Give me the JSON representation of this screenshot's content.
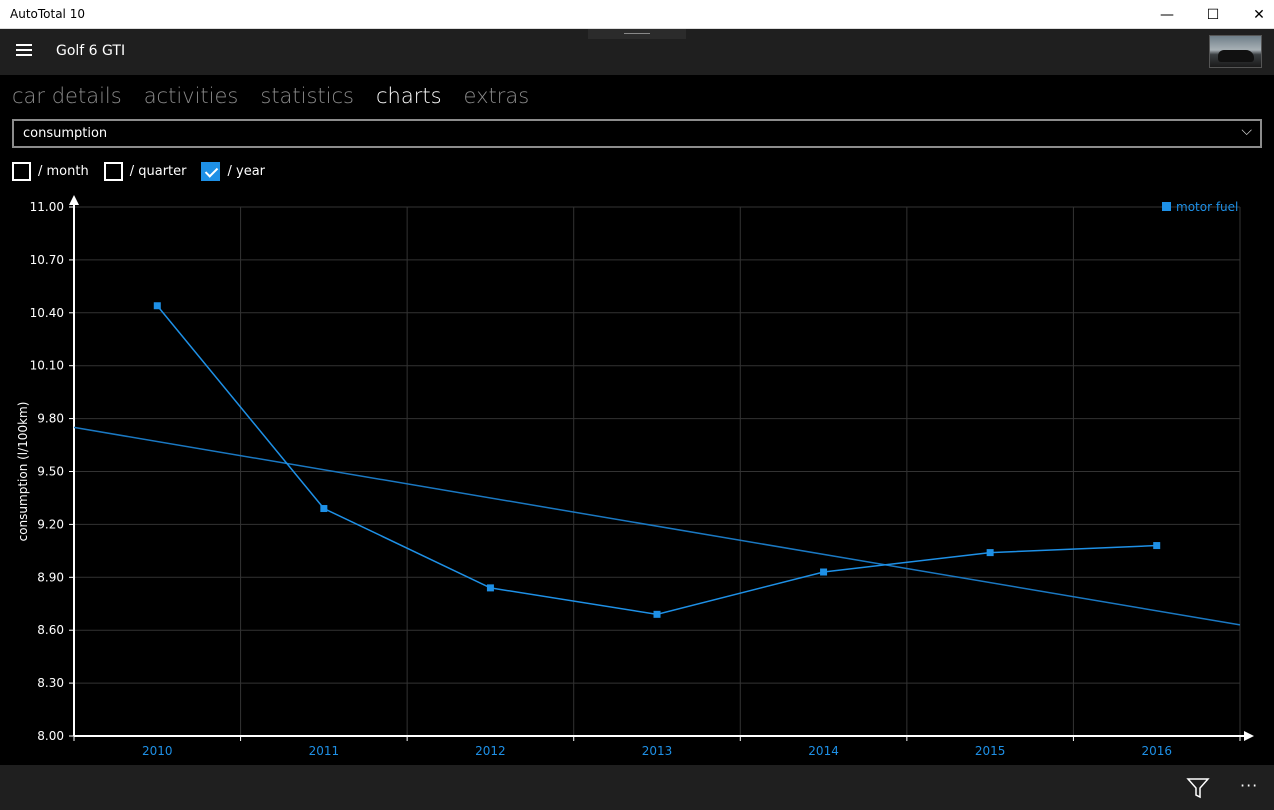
{
  "window": {
    "title": "AutoTotal 10",
    "minimize_glyph": "—",
    "maximize_glyph": "☐",
    "close_glyph": "✕"
  },
  "header": {
    "car_name": "Golf 6 GTI"
  },
  "tabs": [
    {
      "label": "car details",
      "active": false
    },
    {
      "label": "activities",
      "active": false
    },
    {
      "label": "statistics",
      "active": false
    },
    {
      "label": "charts",
      "active": true
    },
    {
      "label": "extras",
      "active": false
    }
  ],
  "combo": {
    "selected": "consumption",
    "chevron_glyph": "⌵"
  },
  "checkboxes": [
    {
      "label": "/ month",
      "checked": false
    },
    {
      "label": "/ quarter",
      "checked": false
    },
    {
      "label": "/ year",
      "checked": true
    }
  ],
  "chart_data": {
    "type": "line",
    "ylabel": "consumption (l/100km)",
    "xlabel": "",
    "ylim": [
      8.0,
      11.0
    ],
    "yticks": [
      "8.00",
      "8.30",
      "8.60",
      "8.90",
      "9.20",
      "9.50",
      "9.80",
      "10.10",
      "10.40",
      "10.70",
      "11.00"
    ],
    "categories": [
      "2010",
      "2011",
      "2012",
      "2013",
      "2014",
      "2015",
      "2016"
    ],
    "grid": true,
    "legend_position": "top-right",
    "series": [
      {
        "name": "motor fuel",
        "values": [
          10.44,
          9.29,
          8.84,
          8.69,
          8.93,
          9.04,
          9.08
        ],
        "color": "#1e90e6"
      }
    ],
    "trendline": {
      "start": 9.75,
      "end": 8.63,
      "color": "#1a78c2"
    }
  },
  "colors": {
    "accent": "#1e90e6",
    "axis_label": "#1e90e6"
  },
  "commandbar": {
    "more_glyph": "···"
  }
}
